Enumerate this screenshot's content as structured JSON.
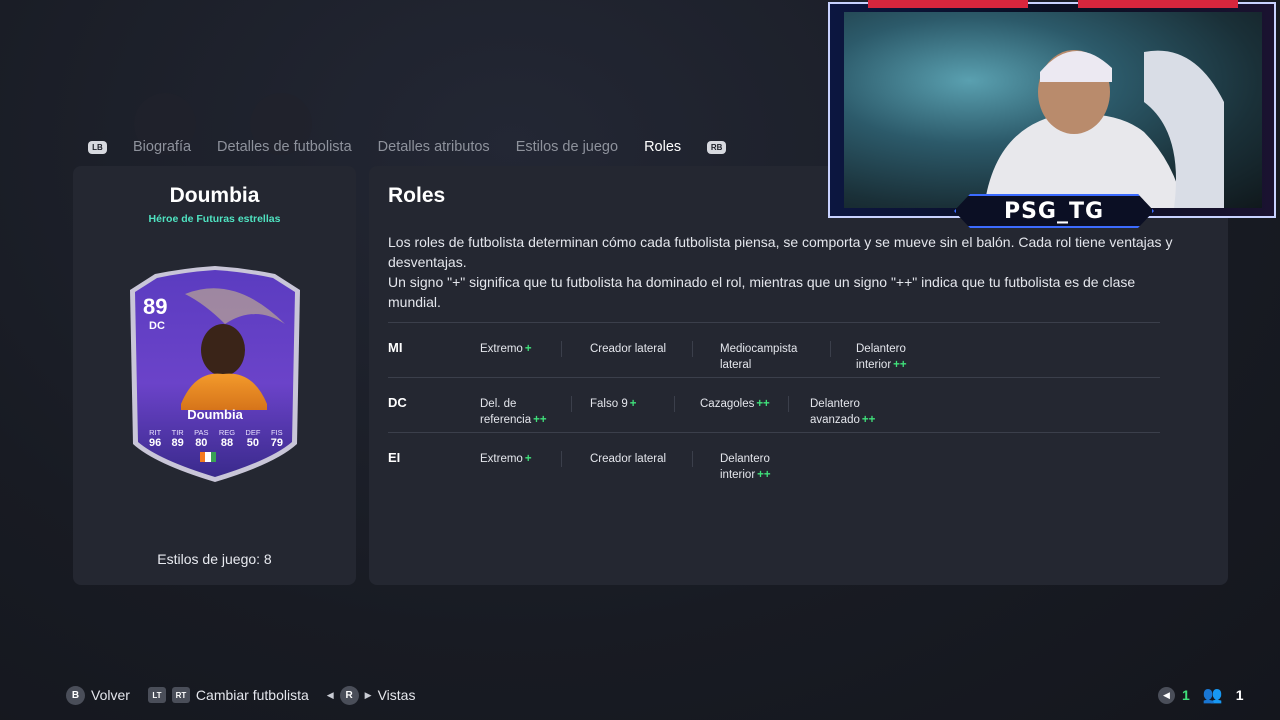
{
  "tabs": {
    "left_bumper": "LB",
    "right_bumper": "RB",
    "items": [
      {
        "label": "Biografía"
      },
      {
        "label": "Detalles de futbolista"
      },
      {
        "label": "Detalles atributos"
      },
      {
        "label": "Estilos de juego"
      },
      {
        "label": "Roles",
        "active": true
      }
    ]
  },
  "player": {
    "name": "Doumbia",
    "subtitle": "Héroe de Futuras estrellas",
    "playstyles": "Estilos de juego: 8",
    "card": {
      "rating": "89",
      "position": "DC",
      "name": "Doumbia",
      "stats": [
        {
          "label": "RIT",
          "value": "96"
        },
        {
          "label": "TIR",
          "value": "89"
        },
        {
          "label": "PAS",
          "value": "80"
        },
        {
          "label": "REG",
          "value": "88"
        },
        {
          "label": "DEF",
          "value": "50"
        },
        {
          "label": "FIS",
          "value": "79"
        }
      ]
    }
  },
  "roles_panel": {
    "title": "Roles",
    "description_1": "Los roles de futbolista determinan cómo cada futbolista piensa, se comporta y se mueve sin el balón. Cada rol tiene ventajas y desventajas.",
    "description_2": "Un signo \"+\" significa que tu futbolista ha dominado el rol, mientras que un signo \"++\" indica que tu futbolista es de clase mundial.",
    "rows": [
      {
        "position": "MI",
        "roles": [
          {
            "name": "Extremo",
            "plus": "+"
          },
          {
            "name": "Creador lateral",
            "plus": ""
          },
          {
            "name": "Mediocampista lateral",
            "plus": ""
          },
          {
            "name": "Delantero interior",
            "plus": "++"
          }
        ]
      },
      {
        "position": "DC",
        "roles": [
          {
            "name": "Del. de referencia",
            "plus": "++"
          },
          {
            "name": "Falso 9",
            "plus": "+"
          },
          {
            "name": "Cazagoles",
            "plus": "++"
          },
          {
            "name": "Delantero avanzado",
            "plus": "++"
          }
        ]
      },
      {
        "position": "EI",
        "roles": [
          {
            "name": "Extremo",
            "plus": "+"
          },
          {
            "name": "Creador lateral",
            "plus": ""
          },
          {
            "name": "Delantero interior",
            "plus": "++"
          }
        ]
      }
    ]
  },
  "overlay": {
    "streamer_tag": "PSG_TG"
  },
  "footer": {
    "back_button": "B",
    "back_label": "Volver",
    "lt": "LT",
    "rt": "RT",
    "change_label": "Cambiar futbolista",
    "views_button": "R",
    "views_label": "Vistas",
    "count_1": "1",
    "count_2": "1"
  },
  "colors": {
    "accent_green": "#3fe07a",
    "subtitle_teal": "#4fe3c1",
    "panel_bg": "#242731",
    "card_purple": "#6b43c9"
  }
}
